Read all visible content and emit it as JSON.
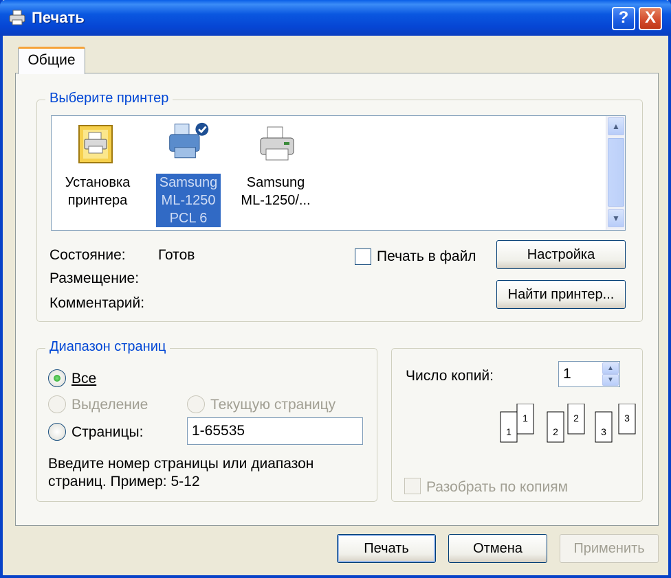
{
  "window": {
    "title": "Печать",
    "help_label": "?",
    "close_label": "X"
  },
  "tabs": [
    {
      "label": "Общие"
    }
  ],
  "printer_group": {
    "legend": "Выберите принтер",
    "printers": [
      {
        "label": "Установка\nпринтера",
        "icon": "add-printer-icon"
      },
      {
        "label": "Samsung\nML-1250\nPCL 6",
        "icon": "default-printer-icon",
        "selected": true
      },
      {
        "label": "Samsung\nML-1250/...",
        "icon": "printer-icon"
      }
    ],
    "status_label": "Состояние:",
    "status_value": "Готов",
    "location_label": "Размещение:",
    "comment_label": "Комментарий:",
    "print_to_file_label": "Печать в файл",
    "preferences_button": "Настройка",
    "find_printer_button": "Найти принтер..."
  },
  "page_range": {
    "legend": "Диапазон страниц",
    "all_label": "Все",
    "selection_label": "Выделение",
    "current_page_label": "Текущую страницу",
    "pages_label": "Страницы:",
    "pages_value": "1-65535",
    "hint_line1": "Введите номер страницы или диапазон",
    "hint_line2": "страниц.  Пример: 5-12"
  },
  "copies": {
    "label": "Число копий:",
    "value": "1",
    "collate_label": "Разобрать по копиям",
    "illustration_numbers": [
      "1",
      "1",
      "2",
      "2",
      "3",
      "3"
    ]
  },
  "footer": {
    "print_button": "Печать",
    "cancel_button": "Отмена",
    "apply_button": "Применить"
  }
}
